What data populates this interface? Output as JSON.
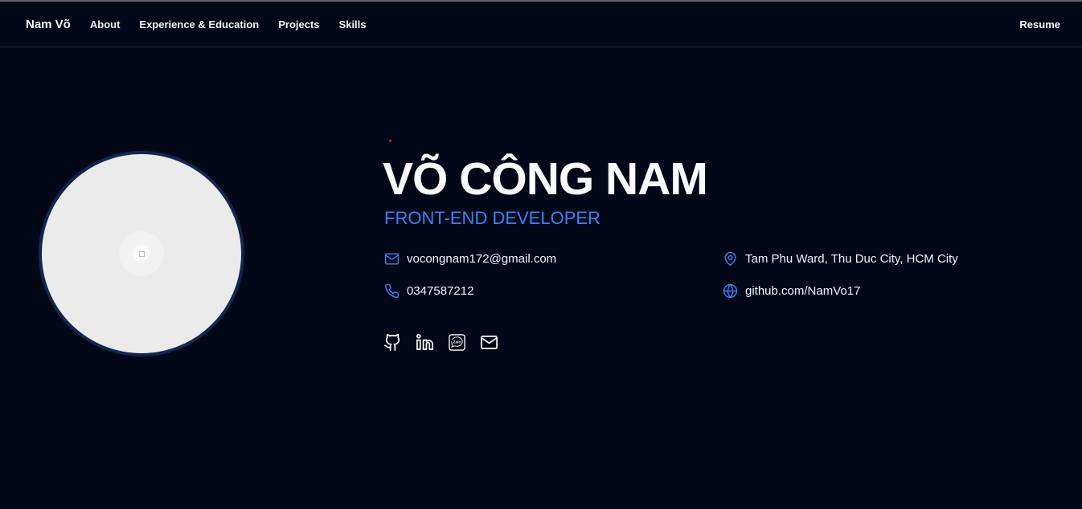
{
  "nav": {
    "brand": "Nam Võ",
    "links": [
      "About",
      "Experience & Education",
      "Projects",
      "Skills"
    ],
    "resume": "Resume"
  },
  "hero": {
    "name": "VÕ CÔNG NAM",
    "role": "FRONT-END DEVELOPER",
    "email": "vocongnam172@gmail.com",
    "phone": "0347587212",
    "location": "Tam Phu Ward, Thu Duc City, HCM City",
    "website": "github.com/NamVo17",
    "zalo_label": "Zalo"
  },
  "colors": {
    "background": "#020817",
    "accent": "#3b82f6"
  }
}
